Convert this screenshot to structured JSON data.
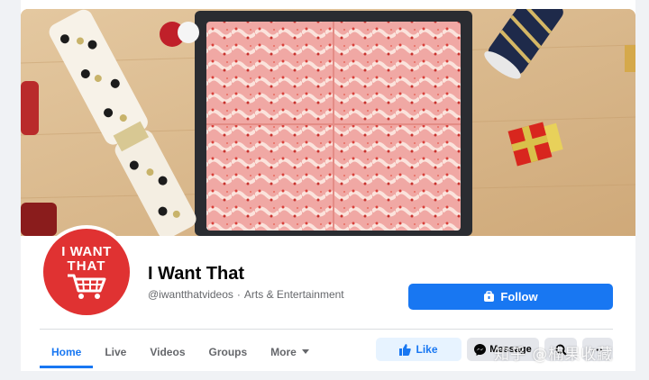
{
  "page": {
    "name": "I Want That",
    "handle": "@iwantthatvideos",
    "separator": "·",
    "category": "Arts & Entertainment"
  },
  "avatar": {
    "line1": "I WANT",
    "line2": "THAT",
    "color": "#e03232"
  },
  "actions": {
    "follow_label": "Follow",
    "like_label": "Like",
    "message_label": "Message",
    "more_label": "···"
  },
  "tabs": [
    {
      "label": "Home",
      "active": true
    },
    {
      "label": "Live"
    },
    {
      "label": "Videos"
    },
    {
      "label": "Groups"
    },
    {
      "label": "More"
    }
  ],
  "watermark": "知乎 @楠果收藏",
  "colors": {
    "accent": "#1877f2",
    "background": "#f0f2f5",
    "text_secondary": "#65676b"
  },
  "icons": [
    "follow-icon",
    "like-thumb-icon",
    "messenger-icon",
    "search-icon",
    "caret-down-icon",
    "cart-icon"
  ]
}
